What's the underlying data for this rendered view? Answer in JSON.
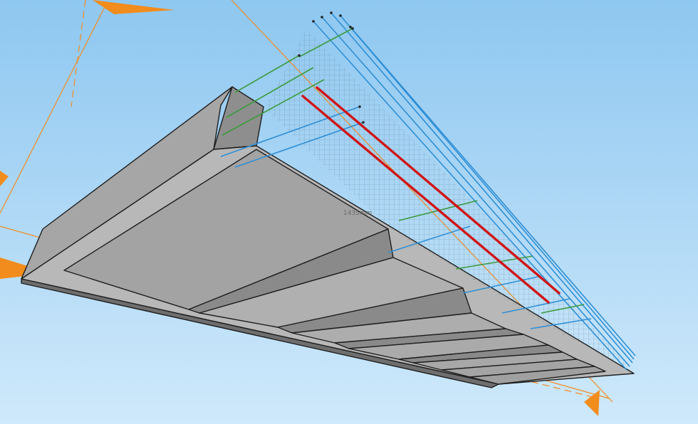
{
  "colors": {
    "sky_top": "#8ec7f0",
    "sky_bottom": "#cfe9fb",
    "concrete_light": "#b4b4b4",
    "concrete_mid": "#9c9c9c",
    "concrete_dark": "#7a7a7a",
    "edge": "#1e1e1e",
    "rebar_blue": "#2f8fd6",
    "rebar_green": "#3b9b3b",
    "rebar_red": "#d01515",
    "mesh": "#5a6a72",
    "axis_orange": "#f28c1c"
  },
  "dimension_label": "1435mm"
}
